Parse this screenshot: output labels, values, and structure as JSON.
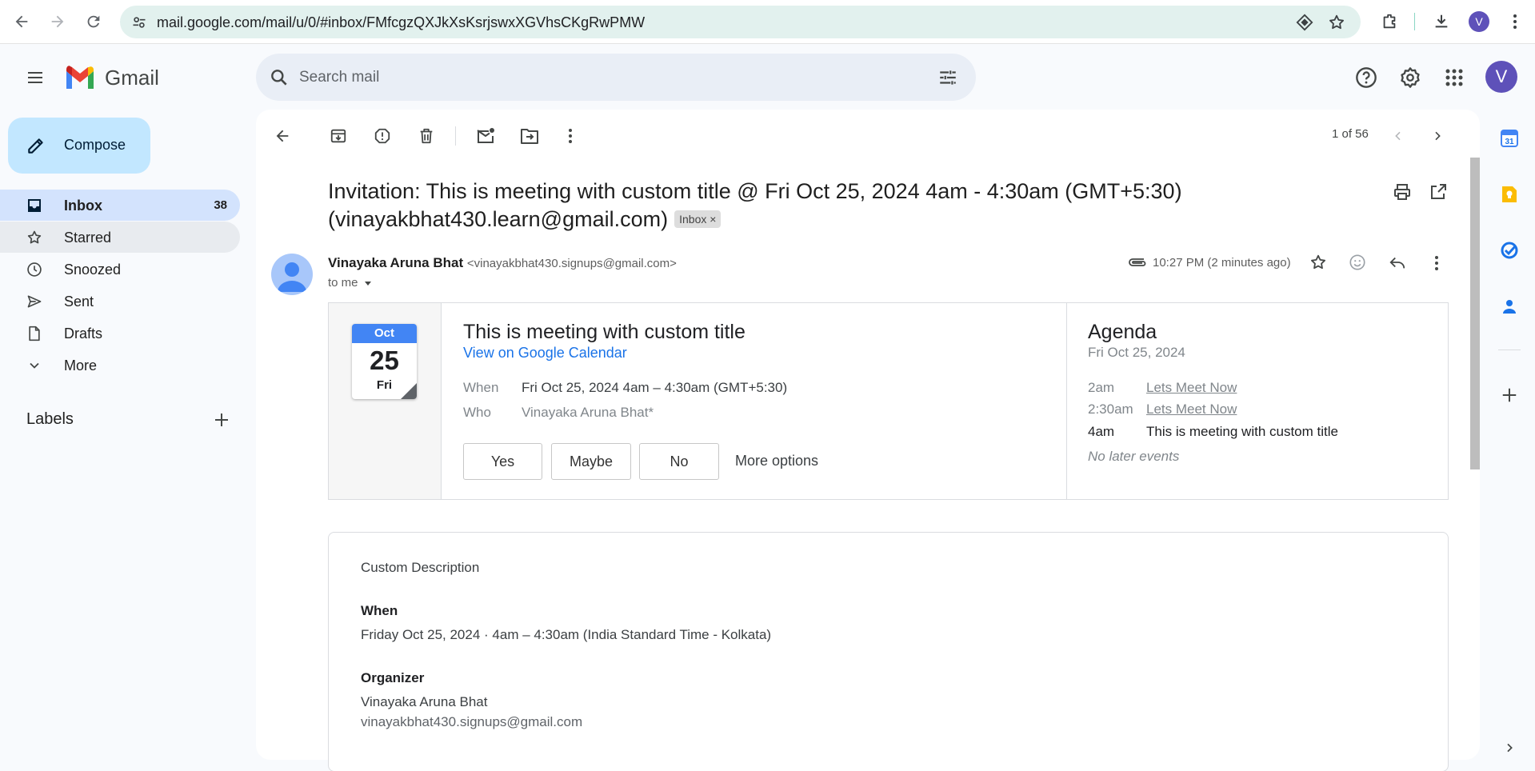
{
  "browser": {
    "url": "mail.google.com/mail/u/0/#inbox/FMfcgzQXJkXsKsrjswxXGVhsCKgRwPMW",
    "profile_initial": "V"
  },
  "header": {
    "app_name": "Gmail",
    "search_placeholder": "Search mail",
    "avatar_initial": "V"
  },
  "sidebar": {
    "compose_label": "Compose",
    "items": [
      {
        "label": "Inbox",
        "count": "38"
      },
      {
        "label": "Starred"
      },
      {
        "label": "Snoozed"
      },
      {
        "label": "Sent"
      },
      {
        "label": "Drafts"
      },
      {
        "label": "More"
      }
    ],
    "labels_heading": "Labels"
  },
  "toolbar": {
    "pager": "1 of 56"
  },
  "email": {
    "subject": "Invitation: This is meeting with custom title @ Fri Oct 25, 2024 4am - 4:30am (GMT+5:30) (vinayakbhat430.learn@gmail.com)",
    "label_chip": "Inbox",
    "sender_name": "Vinayaka Aruna Bhat",
    "sender_email": "<vinayakbhat430.signups@gmail.com>",
    "recipient": "to me",
    "time": "10:27 PM (2 minutes ago)"
  },
  "invite": {
    "month": "Oct",
    "day": "25",
    "weekday": "Fri",
    "title": "This is meeting with custom title",
    "calendar_link": "View on Google Calendar",
    "when_label": "When",
    "when_value": "Fri Oct 25, 2024 4am – 4:30am (GMT+5:30)",
    "who_label": "Who",
    "who_value": "Vinayaka Aruna Bhat*",
    "rsvp_yes": "Yes",
    "rsvp_maybe": "Maybe",
    "rsvp_no": "No",
    "more_options": "More options"
  },
  "agenda": {
    "title": "Agenda",
    "date": "Fri Oct 25, 2024",
    "events": [
      {
        "time": "2am",
        "title": "Lets Meet Now"
      },
      {
        "time": "2:30am",
        "title": "Lets Meet Now"
      },
      {
        "time": "4am",
        "title": "This is meeting with custom title"
      }
    ],
    "footer": "No later events"
  },
  "description": {
    "text": "Custom Description",
    "when_heading": "When",
    "when_value": "Friday Oct 25, 2024 · 4am – 4:30am (India Standard Time - Kolkata)",
    "organizer_heading": "Organizer",
    "organizer_name": "Vinayaka Aruna Bhat",
    "organizer_email": "vinayakbhat430.signups@gmail.com"
  },
  "colors": {
    "accent": "#0b57d0",
    "compose_bg": "#c2e7ff",
    "inbox_selected": "#d3e3fd",
    "omnibox_bg": "#e2f1ee"
  }
}
